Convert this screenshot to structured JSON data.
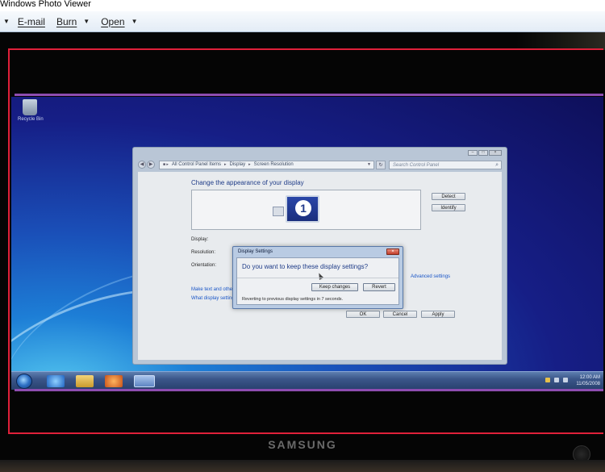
{
  "window": {
    "title": "Windows Photo Viewer"
  },
  "toolbar": {
    "email_label": "E-mail",
    "burn_label": "Burn",
    "open_label": "Open"
  },
  "photo": {
    "bezel_brand": "SAMSUNG",
    "desktop": {
      "recycle_label": "Recycle Bin"
    },
    "control_panel": {
      "breadcrumb": [
        "All Control Panel Items",
        "Display",
        "Screen Resolution"
      ],
      "search_placeholder": "Search Control Panel",
      "heading": "Change the appearance of your display",
      "monitor_number": "1",
      "detect_label": "Detect",
      "identify_label": "Identify",
      "display_label": "Display:",
      "resolution_label": "Resolution:",
      "orientation_label": "Orientation:",
      "advanced_link": "Advanced settings",
      "link_text_size": "Make text and other items larger or smaller",
      "link_which_settings": "What display settings should I choose?",
      "ok_label": "OK",
      "cancel_label": "Cancel",
      "apply_label": "Apply"
    },
    "dialog": {
      "title": "Display Settings",
      "question": "Do you want to keep these display settings?",
      "keep_label": "Keep changes",
      "revert_label": "Revert",
      "note": "Reverting to previous display settings in 7 seconds."
    },
    "taskbar": {
      "time": "12:00 AM",
      "date": "11/05/2008"
    }
  },
  "colors": {
    "annotation_red": "#e0203a",
    "annotation_purple": "#8e4db0",
    "link_blue": "#1a56c7"
  }
}
